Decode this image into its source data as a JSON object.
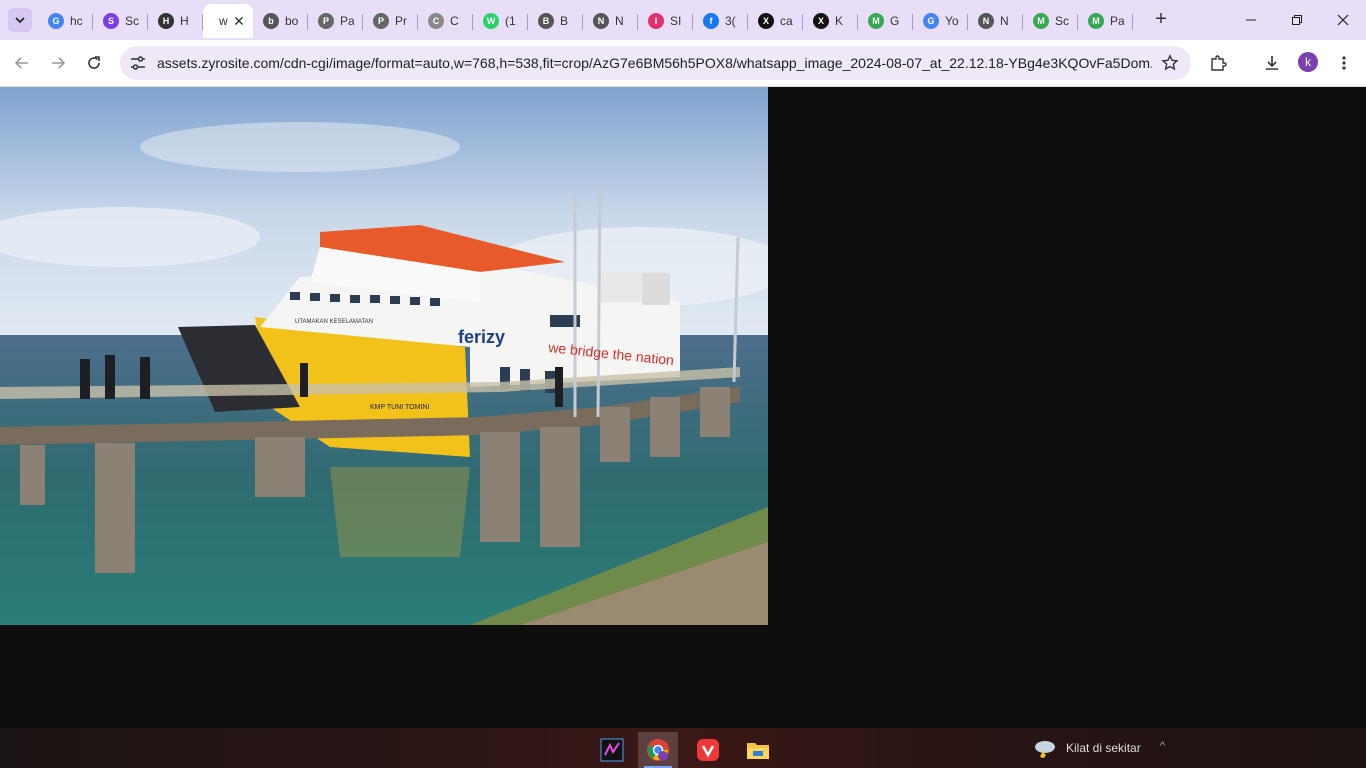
{
  "browser": {
    "tabs": [
      {
        "title": "hc",
        "fav": "G",
        "color": "#4285f4"
      },
      {
        "title": "Sc",
        "fav": "S",
        "color": "#7b3fe4"
      },
      {
        "title": "H",
        "fav": "H",
        "color": "#333333"
      },
      {
        "title": "w",
        "fav": "",
        "color": ""
      },
      {
        "title": "bo",
        "fav": "b",
        "color": "#555555"
      },
      {
        "title": "Pa",
        "fav": "P",
        "color": "#666666"
      },
      {
        "title": "Pr",
        "fav": "P",
        "color": "#666666"
      },
      {
        "title": "C",
        "fav": "C",
        "color": "#888888"
      },
      {
        "title": "(1",
        "fav": "W",
        "color": "#25d366"
      },
      {
        "title": "B",
        "fav": "B",
        "color": "#555555"
      },
      {
        "title": "N",
        "fav": "N",
        "color": "#555555"
      },
      {
        "title": "SI",
        "fav": "I",
        "color": "#e1306c"
      },
      {
        "title": "3(",
        "fav": "f",
        "color": "#1877f2"
      },
      {
        "title": "ca",
        "fav": "X",
        "color": "#111111"
      },
      {
        "title": "K",
        "fav": "X",
        "color": "#111111"
      },
      {
        "title": "G",
        "fav": "M",
        "color": "#34a853"
      },
      {
        "title": "Yo",
        "fav": "G",
        "color": "#4285f4"
      },
      {
        "title": "N",
        "fav": "N",
        "color": "#555555"
      },
      {
        "title": "Sc",
        "fav": "M",
        "color": "#34a853"
      },
      {
        "title": "Pa",
        "fav": "M",
        "color": "#34a853"
      }
    ],
    "active_tab_index": 3,
    "url": "assets.zyrosite.com/cdn-cgi/image/format=auto,w=768,h=538,fit=crop/AzG7e6BM56h5POX8/whatsapp_image_2024-08-07_at_22.12.18-YBg4e3KQOvFa5Dom....",
    "profile_initial": "k"
  },
  "photo": {
    "ship_name": "KMP TUNI TOMINI",
    "brand": "ferizy",
    "slogan": "we bridge the nation",
    "deck_text": "UTAMAKAN KESELAMATAN"
  },
  "taskbar": {
    "weather_text": "Kilat di sekitar",
    "apps": [
      "vscode-like",
      "chrome",
      "vivaldi",
      "file-explorer"
    ]
  },
  "colors": {
    "tabstrip": "#e8def8",
    "omnibox": "#efe9f7",
    "page_bg": "#0e0e0e"
  }
}
